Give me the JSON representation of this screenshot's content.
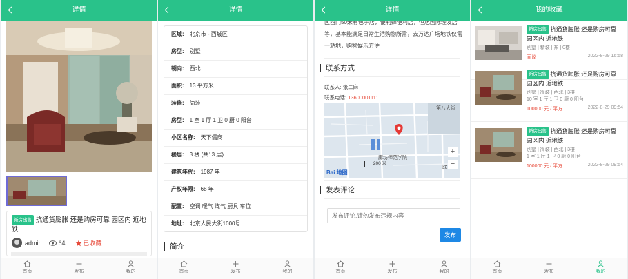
{
  "panels": {
    "detail_title": "详情",
    "fav_title": "我的收藏"
  },
  "footer": {
    "home": "首页",
    "publish": "发布",
    "mine": "我的"
  },
  "listing": {
    "tag": "新房出售",
    "title": "抗通货膨胀 还是购房可靠 园区内 近地铁",
    "author": "admin",
    "views": "64",
    "fav_label": "已收藏"
  },
  "attrs": [
    {
      "label": "区域:",
      "value": "北京市 - 西城区"
    },
    {
      "label": "房型:",
      "value": "别墅"
    },
    {
      "label": "朝向:",
      "value": "西北"
    },
    {
      "label": "面积:",
      "value": "13 平方米"
    },
    {
      "label": "装修:",
      "value": "简装"
    },
    {
      "label": "房型:",
      "value": "1 室 1 厅 1 卫 0 厨 0 阳台"
    },
    {
      "label": "小区名称:",
      "value": "天下儒商"
    },
    {
      "label": "楼层:",
      "value": "3 楼 (共13 层)"
    },
    {
      "label": "建筑年代:",
      "value": "1987 年"
    },
    {
      "label": "产权年限:",
      "value": "68 年"
    },
    {
      "label": "配置:",
      "value": "空调 暖气 煤气 厨具 车位"
    },
    {
      "label": "地址:",
      "value": "北京人民大街1000号"
    }
  ],
  "intro_heading": "简介",
  "description": "区西门50米有包子店，便利蜂便利店，恒旭国际理发店等，基本能满足日常生活购物所需，去万达广场地铁仅需一站地，购物娱乐方便",
  "contact": {
    "heading": "联系方式",
    "person_label": "联系人:",
    "person": "张二麻",
    "phone_label": "联系电话:",
    "phone": "13600001111"
  },
  "map": {
    "label_top": "第八大街",
    "label_place": "廊坊师范学院",
    "label_bottom": "联",
    "scale": "200 米",
    "brand": "Bai 地图",
    "zoom_in": "+",
    "zoom_out": "−"
  },
  "comment": {
    "heading": "发表评论",
    "placeholder": "发布评论,请勿发布违规内容",
    "submit": "发布"
  },
  "favorites": [
    {
      "tag": "新房出售",
      "title": "抗通货膨胀 还是购房可靠 园区内 近地铁",
      "spec": "别墅 | 精装 | 东 | 0楼",
      "rooms": "",
      "price": "面议",
      "date": "2022-8-29 16:58"
    },
    {
      "tag": "新房出售",
      "title": "抗通货膨胀 还是购房可靠 园区内 近地铁",
      "spec": "别墅 | 简装 | 西北 | 3楼",
      "rooms": "10 室 1 厅 1 卫 0 厨 0 阳台",
      "price": "100000 元 / 平方",
      "date": "2022-8-29 09:54"
    },
    {
      "tag": "新房出售",
      "title": "抗通货膨胀 还是购房可靠 园区内 近地铁",
      "spec": "别墅 | 简装 | 西北 | 3楼",
      "rooms": "1 室 1 厅 1 卫 0 厨 0 阳台",
      "price": "100000 元 / 平方",
      "date": "2022-8-29 09:54"
    }
  ]
}
